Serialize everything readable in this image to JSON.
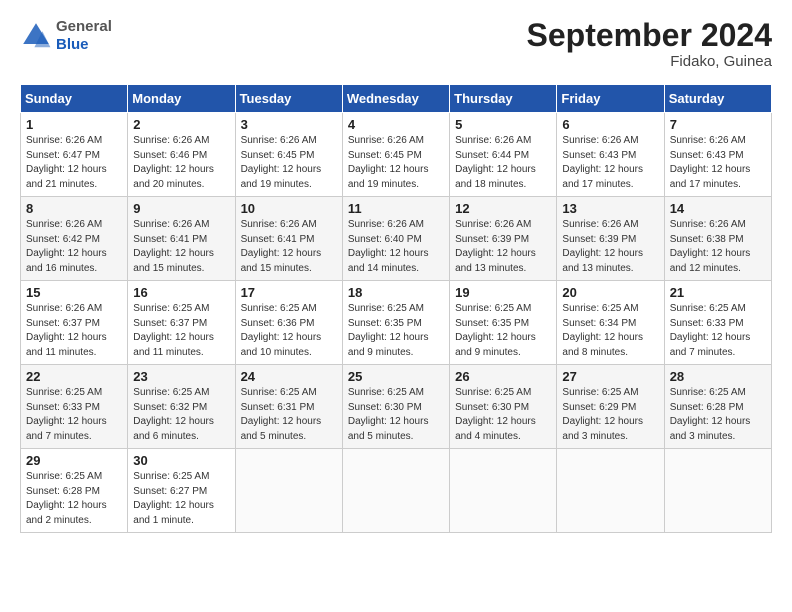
{
  "header": {
    "logo_general": "General",
    "logo_blue": "Blue",
    "month_title": "September 2024",
    "location": "Fidako, Guinea"
  },
  "columns": [
    "Sunday",
    "Monday",
    "Tuesday",
    "Wednesday",
    "Thursday",
    "Friday",
    "Saturday"
  ],
  "weeks": [
    [
      {
        "day": "1",
        "sunrise": "Sunrise: 6:26 AM",
        "sunset": "Sunset: 6:47 PM",
        "daylight": "Daylight: 12 hours and 21 minutes."
      },
      {
        "day": "2",
        "sunrise": "Sunrise: 6:26 AM",
        "sunset": "Sunset: 6:46 PM",
        "daylight": "Daylight: 12 hours and 20 minutes."
      },
      {
        "day": "3",
        "sunrise": "Sunrise: 6:26 AM",
        "sunset": "Sunset: 6:45 PM",
        "daylight": "Daylight: 12 hours and 19 minutes."
      },
      {
        "day": "4",
        "sunrise": "Sunrise: 6:26 AM",
        "sunset": "Sunset: 6:45 PM",
        "daylight": "Daylight: 12 hours and 19 minutes."
      },
      {
        "day": "5",
        "sunrise": "Sunrise: 6:26 AM",
        "sunset": "Sunset: 6:44 PM",
        "daylight": "Daylight: 12 hours and 18 minutes."
      },
      {
        "day": "6",
        "sunrise": "Sunrise: 6:26 AM",
        "sunset": "Sunset: 6:43 PM",
        "daylight": "Daylight: 12 hours and 17 minutes."
      },
      {
        "day": "7",
        "sunrise": "Sunrise: 6:26 AM",
        "sunset": "Sunset: 6:43 PM",
        "daylight": "Daylight: 12 hours and 17 minutes."
      }
    ],
    [
      {
        "day": "8",
        "sunrise": "Sunrise: 6:26 AM",
        "sunset": "Sunset: 6:42 PM",
        "daylight": "Daylight: 12 hours and 16 minutes."
      },
      {
        "day": "9",
        "sunrise": "Sunrise: 6:26 AM",
        "sunset": "Sunset: 6:41 PM",
        "daylight": "Daylight: 12 hours and 15 minutes."
      },
      {
        "day": "10",
        "sunrise": "Sunrise: 6:26 AM",
        "sunset": "Sunset: 6:41 PM",
        "daylight": "Daylight: 12 hours and 15 minutes."
      },
      {
        "day": "11",
        "sunrise": "Sunrise: 6:26 AM",
        "sunset": "Sunset: 6:40 PM",
        "daylight": "Daylight: 12 hours and 14 minutes."
      },
      {
        "day": "12",
        "sunrise": "Sunrise: 6:26 AM",
        "sunset": "Sunset: 6:39 PM",
        "daylight": "Daylight: 12 hours and 13 minutes."
      },
      {
        "day": "13",
        "sunrise": "Sunrise: 6:26 AM",
        "sunset": "Sunset: 6:39 PM",
        "daylight": "Daylight: 12 hours and 13 minutes."
      },
      {
        "day": "14",
        "sunrise": "Sunrise: 6:26 AM",
        "sunset": "Sunset: 6:38 PM",
        "daylight": "Daylight: 12 hours and 12 minutes."
      }
    ],
    [
      {
        "day": "15",
        "sunrise": "Sunrise: 6:26 AM",
        "sunset": "Sunset: 6:37 PM",
        "daylight": "Daylight: 12 hours and 11 minutes."
      },
      {
        "day": "16",
        "sunrise": "Sunrise: 6:25 AM",
        "sunset": "Sunset: 6:37 PM",
        "daylight": "Daylight: 12 hours and 11 minutes."
      },
      {
        "day": "17",
        "sunrise": "Sunrise: 6:25 AM",
        "sunset": "Sunset: 6:36 PM",
        "daylight": "Daylight: 12 hours and 10 minutes."
      },
      {
        "day": "18",
        "sunrise": "Sunrise: 6:25 AM",
        "sunset": "Sunset: 6:35 PM",
        "daylight": "Daylight: 12 hours and 9 minutes."
      },
      {
        "day": "19",
        "sunrise": "Sunrise: 6:25 AM",
        "sunset": "Sunset: 6:35 PM",
        "daylight": "Daylight: 12 hours and 9 minutes."
      },
      {
        "day": "20",
        "sunrise": "Sunrise: 6:25 AM",
        "sunset": "Sunset: 6:34 PM",
        "daylight": "Daylight: 12 hours and 8 minutes."
      },
      {
        "day": "21",
        "sunrise": "Sunrise: 6:25 AM",
        "sunset": "Sunset: 6:33 PM",
        "daylight": "Daylight: 12 hours and 7 minutes."
      }
    ],
    [
      {
        "day": "22",
        "sunrise": "Sunrise: 6:25 AM",
        "sunset": "Sunset: 6:33 PM",
        "daylight": "Daylight: 12 hours and 7 minutes."
      },
      {
        "day": "23",
        "sunrise": "Sunrise: 6:25 AM",
        "sunset": "Sunset: 6:32 PM",
        "daylight": "Daylight: 12 hours and 6 minutes."
      },
      {
        "day": "24",
        "sunrise": "Sunrise: 6:25 AM",
        "sunset": "Sunset: 6:31 PM",
        "daylight": "Daylight: 12 hours and 5 minutes."
      },
      {
        "day": "25",
        "sunrise": "Sunrise: 6:25 AM",
        "sunset": "Sunset: 6:30 PM",
        "daylight": "Daylight: 12 hours and 5 minutes."
      },
      {
        "day": "26",
        "sunrise": "Sunrise: 6:25 AM",
        "sunset": "Sunset: 6:30 PM",
        "daylight": "Daylight: 12 hours and 4 minutes."
      },
      {
        "day": "27",
        "sunrise": "Sunrise: 6:25 AM",
        "sunset": "Sunset: 6:29 PM",
        "daylight": "Daylight: 12 hours and 3 minutes."
      },
      {
        "day": "28",
        "sunrise": "Sunrise: 6:25 AM",
        "sunset": "Sunset: 6:28 PM",
        "daylight": "Daylight: 12 hours and 3 minutes."
      }
    ],
    [
      {
        "day": "29",
        "sunrise": "Sunrise: 6:25 AM",
        "sunset": "Sunset: 6:28 PM",
        "daylight": "Daylight: 12 hours and 2 minutes."
      },
      {
        "day": "30",
        "sunrise": "Sunrise: 6:25 AM",
        "sunset": "Sunset: 6:27 PM",
        "daylight": "Daylight: 12 hours and 1 minute."
      },
      null,
      null,
      null,
      null,
      null
    ]
  ]
}
